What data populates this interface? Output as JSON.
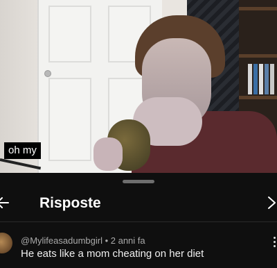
{
  "video": {
    "caption": "oh my"
  },
  "sheet": {
    "title": "Risposte",
    "back_icon": "arrow-left-icon",
    "close_icon": "chevron-right-icon"
  },
  "comment": {
    "author": "@Mylifeasadumbgirl",
    "separator": " • ",
    "time": "2 anni fa",
    "text": "He eats like a mom cheating on her diet",
    "menu_icon": "more-vertical-icon"
  }
}
